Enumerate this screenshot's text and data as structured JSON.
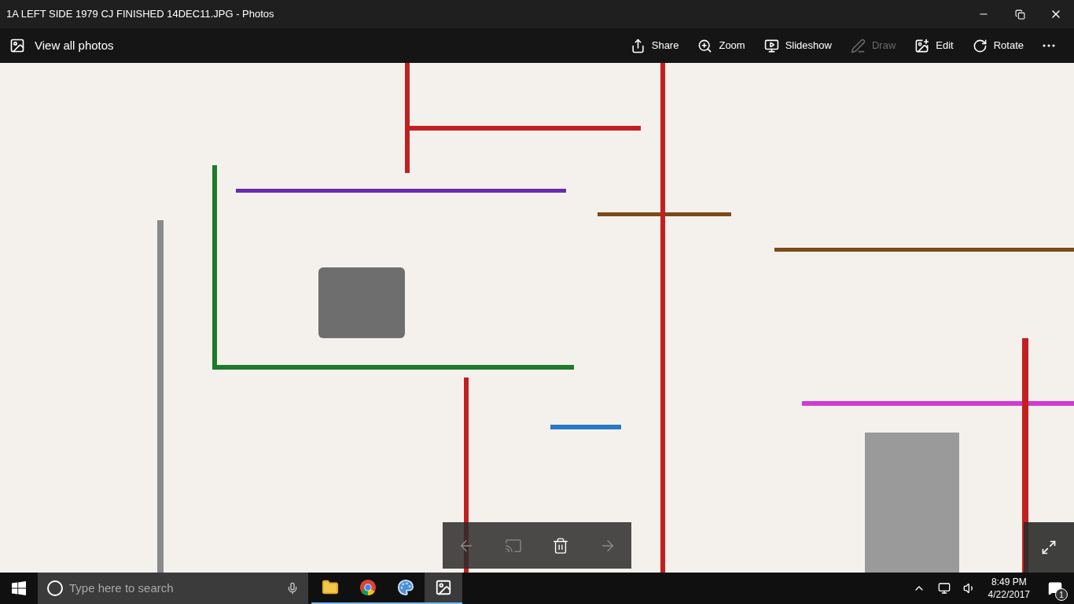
{
  "window": {
    "title": "1A LEFT SIDE 1979 CJ FINISHED 14DEC11.JPG - Photos"
  },
  "toolbar": {
    "back_label": "View all photos",
    "actions": [
      {
        "kind": "share",
        "label": "Share",
        "disabled": false
      },
      {
        "kind": "zoom",
        "label": "Zoom",
        "disabled": false
      },
      {
        "kind": "slideshow",
        "label": "Slideshow",
        "disabled": false
      },
      {
        "kind": "draw",
        "label": "Draw",
        "disabled": true
      },
      {
        "kind": "edit",
        "label": "Edit",
        "disabled": false
      },
      {
        "kind": "rotate",
        "label": "Rotate",
        "disabled": false
      },
      {
        "kind": "more",
        "disabled": false
      }
    ]
  },
  "viewer": {
    "controls": [
      {
        "kind": "previous",
        "disabled": true
      },
      {
        "kind": "cast",
        "disabled": true
      },
      {
        "kind": "delete",
        "disabled": false
      },
      {
        "kind": "next",
        "disabled": true
      }
    ]
  },
  "taskbar": {
    "search": {
      "placeholder": "Type here to search"
    },
    "apps": [
      {
        "kind": "explorer",
        "selected": false
      },
      {
        "kind": "chrome",
        "selected": false
      },
      {
        "kind": "paint",
        "selected": false
      },
      {
        "kind": "photos",
        "selected": true
      }
    ],
    "time": "8:49 PM",
    "date": "4/22/2017",
    "notification_count": "1"
  }
}
